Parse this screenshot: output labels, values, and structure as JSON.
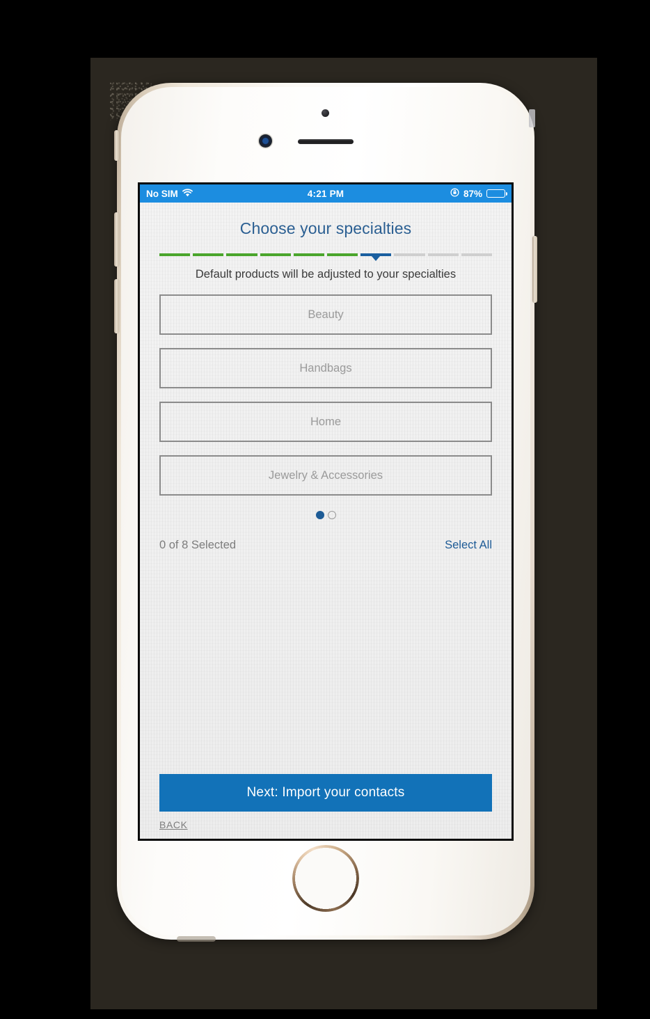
{
  "device": {
    "kind": "smartphone-mockup",
    "hardware": {
      "sensor": "proximity-sensor",
      "camera": "front-camera",
      "speaker": "earpiece-speaker",
      "home": "home-button",
      "mute_switch": "mute-switch",
      "volume_up": "volume-up-button",
      "volume_down": "volume-down-button",
      "power": "power-button"
    }
  },
  "status_bar": {
    "carrier": "No SIM",
    "wifi_icon": "wifi-icon",
    "time": "4:21 PM",
    "rotation_lock_icon": "rotation-lock-icon",
    "battery_percent": "87%",
    "battery_level": 87,
    "battery_icon": "battery-icon",
    "background_color": "#1c8de0",
    "text_color": "#ffffff"
  },
  "screen": {
    "title": "Choose your specialties",
    "title_color": "#2b5f92",
    "subtitle": "Default products will be adjusted to your specialties",
    "progress": {
      "total_steps": 10,
      "completed_steps": 6,
      "current_step": 7,
      "done_color": "#4aa52c",
      "current_color": "#1a5fa0",
      "remaining_color": "#cfcfcf",
      "steps": [
        "done",
        "done",
        "done",
        "done",
        "done",
        "done",
        "current",
        "todo",
        "todo",
        "todo"
      ]
    },
    "options": [
      {
        "label": "Beauty",
        "selected": false
      },
      {
        "label": "Handbags",
        "selected": false
      },
      {
        "label": "Home",
        "selected": false
      },
      {
        "label": "Jewelry & Accessories",
        "selected": false
      }
    ],
    "pager": {
      "total_pages": 2,
      "active_page": 1,
      "dots": [
        "active",
        "inactive"
      ],
      "active_color": "#1d5b96"
    },
    "selection": {
      "count_text": "0 of 8 Selected",
      "selected_count": 0,
      "total_count": 8,
      "select_all_label": "Select All",
      "link_color": "#1d5b96"
    },
    "actions": {
      "next_label": "Next: Import your contacts",
      "next_color": "#1272b8",
      "back_label": "BACK"
    }
  }
}
